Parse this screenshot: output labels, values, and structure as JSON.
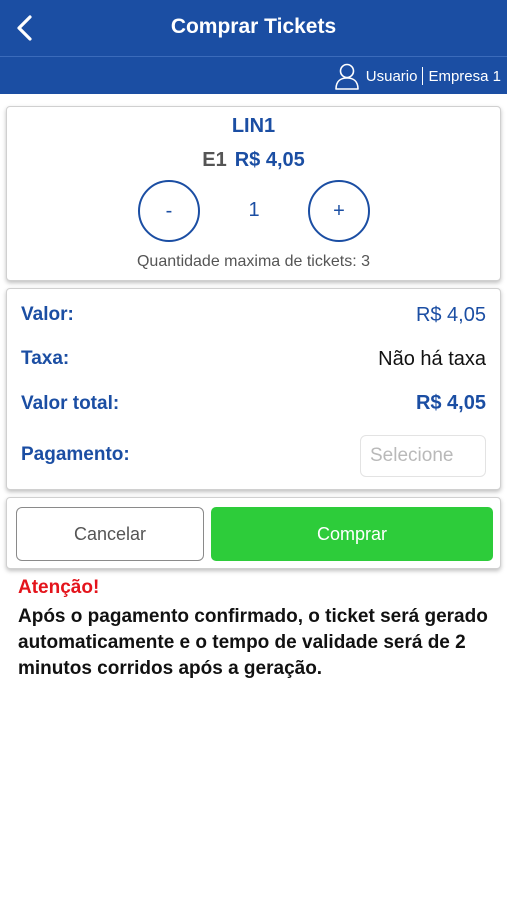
{
  "header": {
    "title": "Comprar Tickets",
    "back_icon": "chevron-left-icon"
  },
  "userbar": {
    "user_icon": "user-icon",
    "user": "Usuario",
    "company": "Empresa 1"
  },
  "product": {
    "line": "LIN1",
    "code": "E1",
    "price": "R$ 4,05",
    "minus_label": "-",
    "plus_label": "+",
    "quantity": "1",
    "max_text": "Quantidade maxima  de tickets: 3"
  },
  "summary": {
    "value_label": "Valor:",
    "value": "R$ 4,05",
    "fee_label": "Taxa:",
    "fee": "Não há taxa",
    "total_label": "Valor total:",
    "total": "R$ 4,05",
    "payment_label": "Pagamento:",
    "payment_placeholder": "Selecione"
  },
  "actions": {
    "cancel": "Cancelar",
    "buy": "Comprar"
  },
  "warning": {
    "title": "Atenção!",
    "text": "Após o pagamento confirmado, o ticket será gerado automaticamente e o tempo de validade será de 2 minutos corridos após a geração."
  },
  "colors": {
    "primary": "#1b4ea3",
    "buy": "#2dcc3a",
    "alert": "#e4141c"
  }
}
